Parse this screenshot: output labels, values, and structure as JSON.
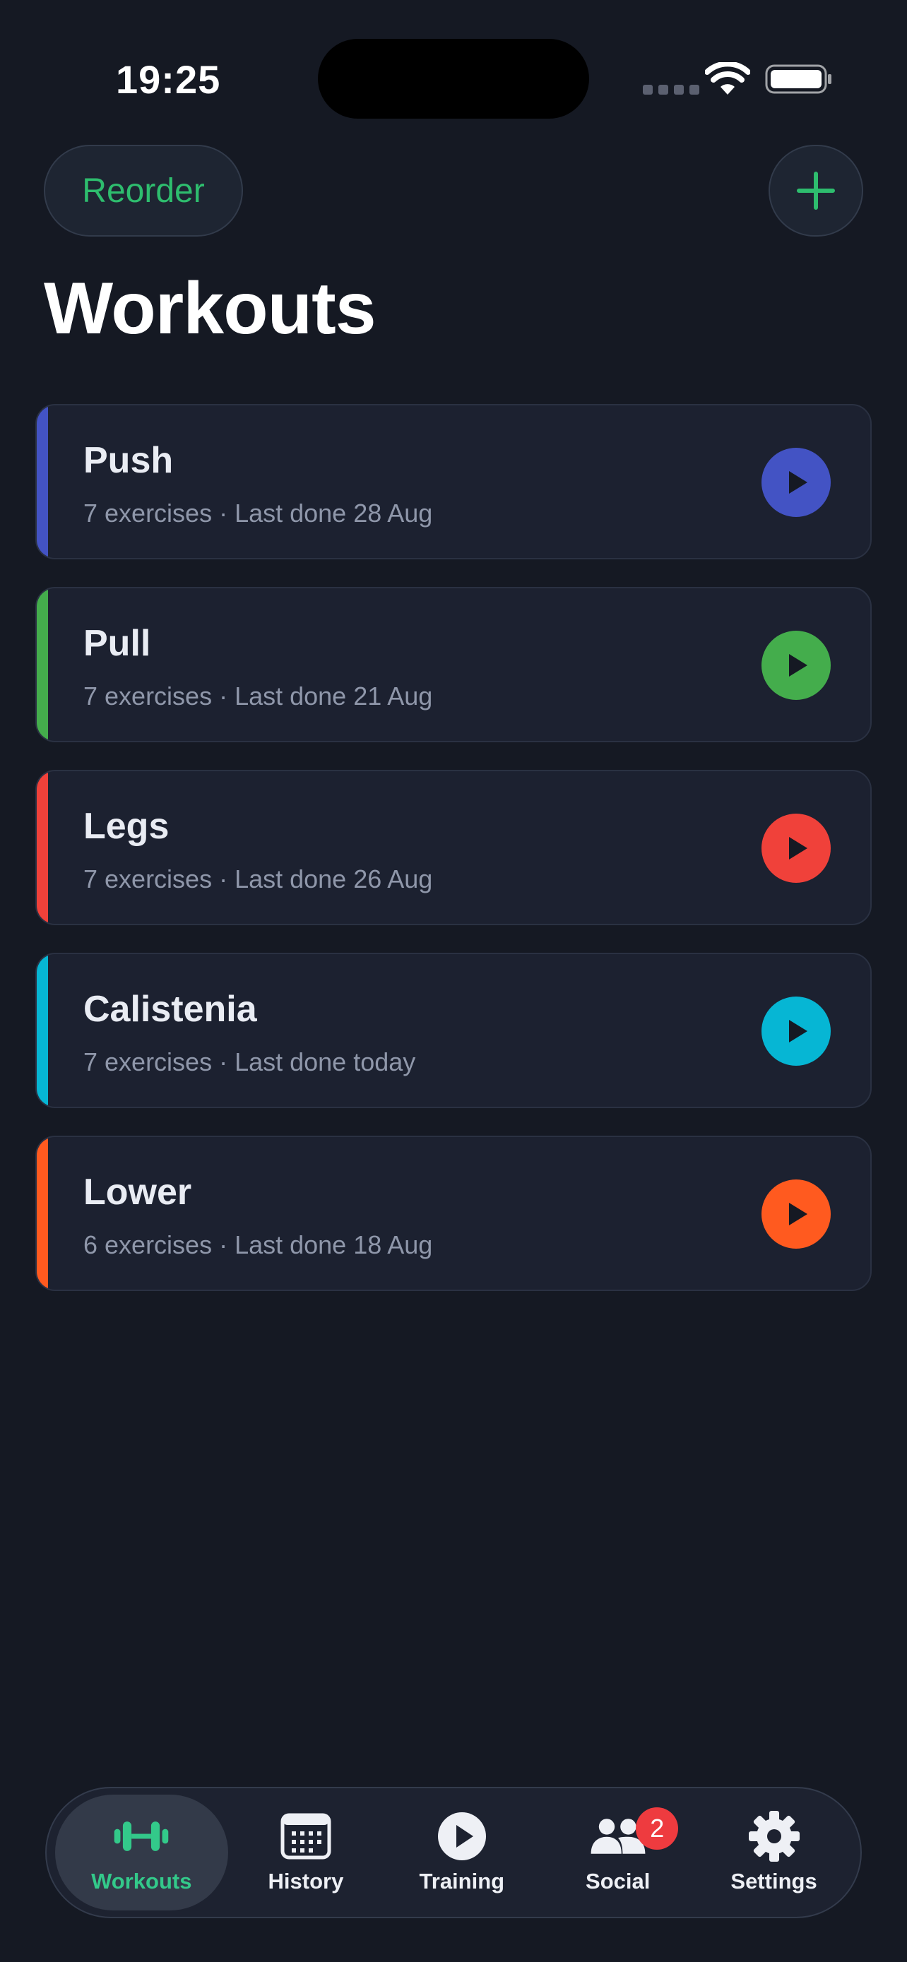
{
  "status_bar": {
    "time": "19:25"
  },
  "header": {
    "reorder_label": "Reorder",
    "title": "Workouts"
  },
  "workouts": [
    {
      "name": "Push",
      "meta": "7 exercises · Last done 28 Aug",
      "color": "#4353c4"
    },
    {
      "name": "Pull",
      "meta": "7 exercises · Last done 21 Aug",
      "color": "#44ad4c"
    },
    {
      "name": "Legs",
      "meta": "7 exercises · Last done 26 Aug",
      "color": "#f0413a"
    },
    {
      "name": "Calistenia",
      "meta": "7 exercises · Last done today",
      "color": "#06b6d4"
    },
    {
      "name": "Lower",
      "meta": "6 exercises · Last done 18 Aug",
      "color": "#ff5a1f"
    }
  ],
  "tab_bar": {
    "tabs": [
      {
        "label": "Workouts",
        "icon": "dumbbell-icon",
        "active": true
      },
      {
        "label": "History",
        "icon": "calendar-icon"
      },
      {
        "label": "Training",
        "icon": "play-circle-icon"
      },
      {
        "label": "Social",
        "icon": "people-icon",
        "badge": "2"
      },
      {
        "label": "Settings",
        "icon": "gear-icon"
      }
    ]
  },
  "colors": {
    "accent": "#33c98a",
    "background": "#151923",
    "badge": "#ee3b3f"
  }
}
